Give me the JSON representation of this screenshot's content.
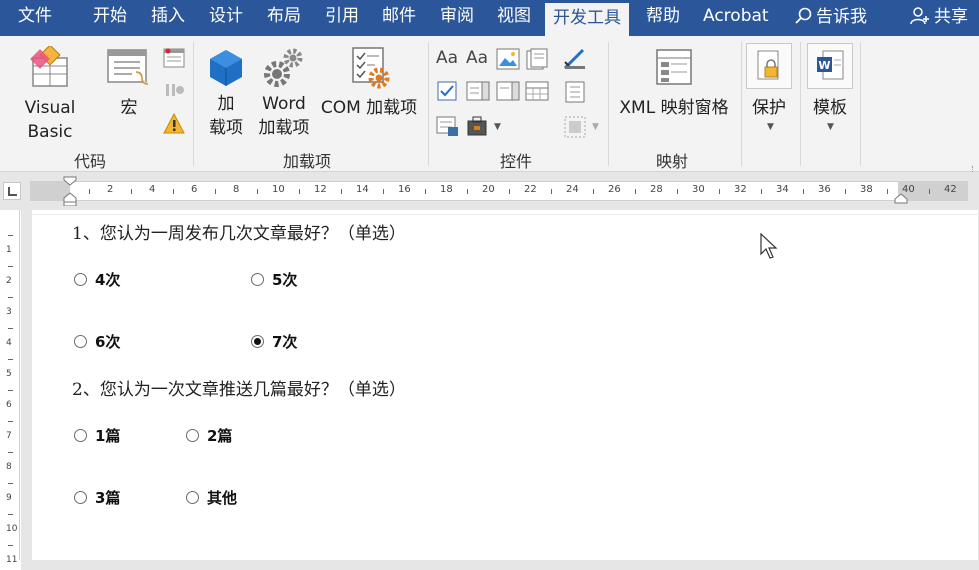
{
  "tabs": [
    {
      "label": "文件",
      "active": false
    },
    {
      "label": "开始",
      "active": false
    },
    {
      "label": "插入",
      "active": false
    },
    {
      "label": "设计",
      "active": false
    },
    {
      "label": "布局",
      "active": false
    },
    {
      "label": "引用",
      "active": false
    },
    {
      "label": "邮件",
      "active": false
    },
    {
      "label": "审阅",
      "active": false
    },
    {
      "label": "视图",
      "active": false
    },
    {
      "label": "开发工具",
      "active": true
    },
    {
      "label": "帮助",
      "active": false
    },
    {
      "label": "Acrobat",
      "active": false
    }
  ],
  "tell_me": "告诉我",
  "share": "共享",
  "ribbon": {
    "code_group": {
      "label": "代码",
      "visual_basic": "Visual Basic",
      "macros": "宏"
    },
    "addins_group": {
      "label": "加载项",
      "addins_line1": "加",
      "addins_line2": "载项",
      "word_addins_line1": "Word",
      "word_addins_line2": "加载项",
      "com_addins": "COM 加载项"
    },
    "controls_group": {
      "label": "控件"
    },
    "mapping_group": {
      "label": "映射",
      "xml_mapping_pane": "XML 映射窗格"
    },
    "protect_group": {
      "protect": "保护"
    },
    "templates_group": {
      "templates": "模板"
    }
  },
  "ruler": {
    "ticks": [
      "2",
      "4",
      "6",
      "8",
      "10",
      "12",
      "14",
      "16",
      "18",
      "20",
      "22",
      "24",
      "26",
      "28",
      "30",
      "32",
      "34",
      "36",
      "38",
      "40",
      "42"
    ]
  },
  "vertical_ruler": {
    "ticks": [
      "1",
      "2",
      "3",
      "4",
      "5",
      "6",
      "7",
      "8",
      "9",
      "10",
      "11"
    ]
  },
  "document": {
    "q1": {
      "text": "1、您认为一周发布几次文章最好？（单选）",
      "options": [
        {
          "label": "4次",
          "checked": false
        },
        {
          "label": "5次",
          "checked": false
        },
        {
          "label": "6次",
          "checked": false
        },
        {
          "label": "7次",
          "checked": true
        }
      ]
    },
    "q2": {
      "text": "2、您认为一次文章推送几篇最好？（单选）",
      "options": [
        {
          "label": "1篇",
          "checked": false
        },
        {
          "label": "2篇",
          "checked": false
        },
        {
          "label": "3篇",
          "checked": false
        },
        {
          "label": "其他",
          "checked": false
        }
      ]
    }
  },
  "colors": {
    "ribbon_blue": "#2b579a",
    "ribbon_bg": "#f3f3f3",
    "addin_blue": "#1f6fc5",
    "gear_grey": "#7a7a7a",
    "gear_orange": "#e07a1f"
  }
}
